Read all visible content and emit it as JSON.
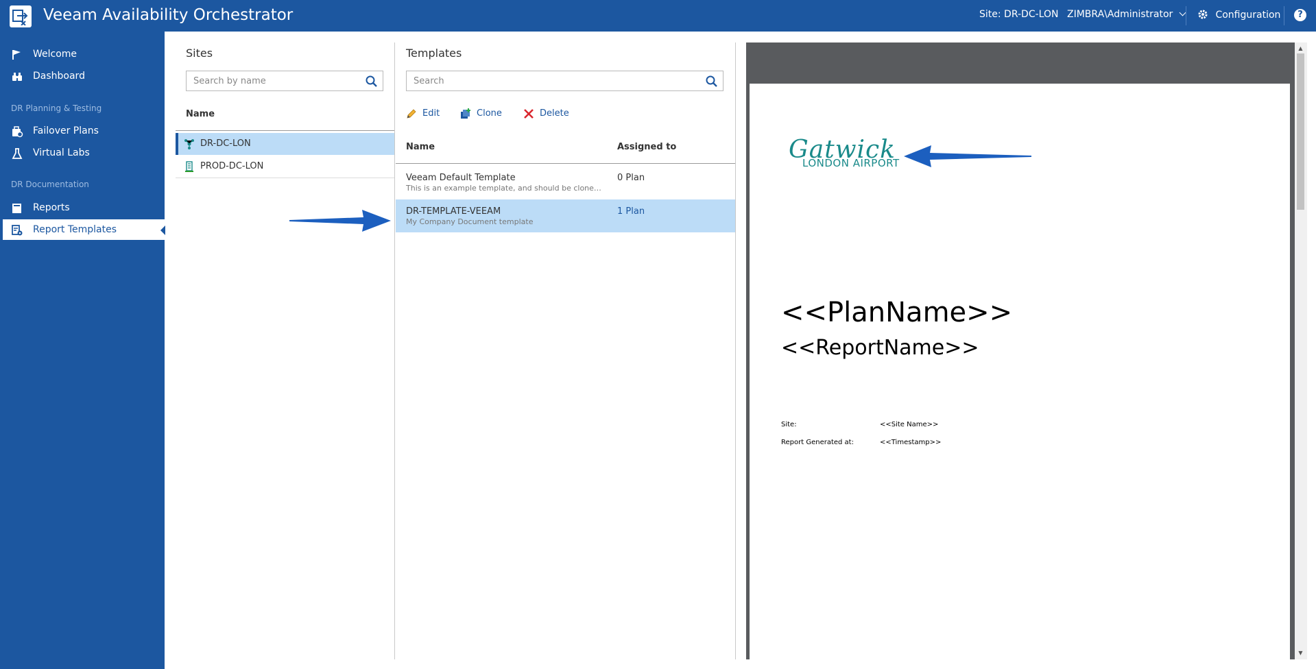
{
  "app": {
    "title": "Veeam Availability Orchestrator",
    "site_label": "Site: DR-DC-LON",
    "user": "ZIMBRA\\Administrator",
    "configuration_label": "Configuration",
    "help_label": "?"
  },
  "sidebar": {
    "items_top": [
      {
        "label": "Welcome",
        "icon": "flag-icon"
      },
      {
        "label": "Dashboard",
        "icon": "binoculars-icon"
      }
    ],
    "section_planning": "DR Planning & Testing",
    "items_planning": [
      {
        "label": "Failover Plans",
        "icon": "failover-plans-icon"
      },
      {
        "label": "Virtual Labs",
        "icon": "flask-icon"
      }
    ],
    "section_documentation": "DR Documentation",
    "items_documentation": [
      {
        "label": "Reports",
        "icon": "reports-icon"
      },
      {
        "label": "Report Templates",
        "icon": "report-templates-icon",
        "active": true
      }
    ]
  },
  "sites": {
    "title": "Sites",
    "search_placeholder": "Search by name",
    "column_name": "Name",
    "rows": [
      {
        "name": "DR-DC-LON",
        "icon": "dr-site-icon",
        "selected": true
      },
      {
        "name": "PROD-DC-LON",
        "icon": "prod-site-icon",
        "selected": false
      }
    ]
  },
  "templates": {
    "title": "Templates",
    "search_placeholder": "Search",
    "toolbar": {
      "edit_label": "Edit",
      "clone_label": "Clone",
      "delete_label": "Delete"
    },
    "column_name": "Name",
    "column_assigned": "Assigned to",
    "rows": [
      {
        "name": "Veeam Default Template",
        "description": "This is an example template, and should be cloned before use",
        "assigned": "0 Plan",
        "selected": false
      },
      {
        "name": "DR-TEMPLATE-VEEAM",
        "description": "My Company Document template",
        "assigned": "1 Plan",
        "selected": true
      }
    ]
  },
  "preview": {
    "logo_word": "Gatwick",
    "logo_sub": "LONDON AIRPORT",
    "plan_name": "<<PlanName>>",
    "report_name": "<<ReportName>>",
    "site_label": "Site:",
    "site_value": "<<Site Name>>",
    "generated_label": "Report Generated at:",
    "generated_value": "<<Timestamp>>"
  },
  "colors": {
    "brand": "#1c57a0",
    "selection": "#bcdcf7",
    "logo_teal": "#1a8a8a",
    "delete_red": "#d9272e"
  }
}
